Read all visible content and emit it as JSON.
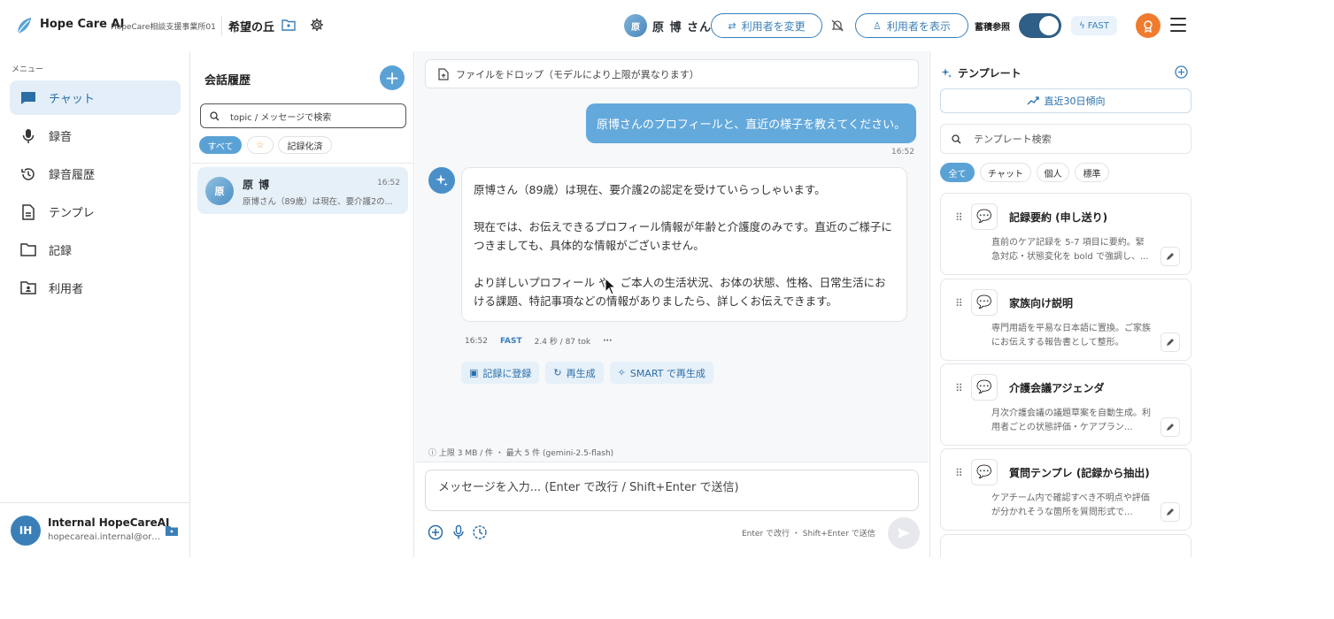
{
  "header": {
    "app_name": "Hope Care AI",
    "office_name": "HopeCare相談支援事業所01",
    "facility_name": "希望の丘",
    "current_user_initial": "原",
    "current_user_name": "原 博 さん",
    "change_user_label": "利用者を変更",
    "show_user_label": "利用者を表示",
    "accumulate_label": "蓄積参照",
    "accumulate_on": true,
    "mode_label": "FAST"
  },
  "sidebar": {
    "menu_title": "メニュー",
    "items": [
      {
        "label": "チャット",
        "icon": "chat-icon",
        "active": true
      },
      {
        "label": "録音",
        "icon": "mic-icon"
      },
      {
        "label": "録音履歴",
        "icon": "history-icon"
      },
      {
        "label": "テンプレ",
        "icon": "document-icon"
      },
      {
        "label": "記録",
        "icon": "folder-icon"
      },
      {
        "label": "利用者",
        "icon": "user-folder-icon"
      }
    ],
    "account": {
      "initials": "IH",
      "name": "Internal HopeCareAI",
      "email": "hopecareai.internal@orde..."
    }
  },
  "history": {
    "title": "会話履歴",
    "search_placeholder": "topic / メッセージで検索",
    "filters": [
      "すべて",
      "☆",
      "記録化済"
    ],
    "conversations": [
      {
        "initial": "原",
        "name": "原 博",
        "time": "16:52",
        "preview": "原博さん（89歳）は現在、要介護2の..."
      }
    ]
  },
  "chat": {
    "dropzone_text": "ファイルをドロップ（モデルにより上限が異なります）",
    "user_message": "原博さんのプロフィールと、直近の様子を教えてください。",
    "user_time": "16:52",
    "ai_paragraphs": [
      "原博さん（89歳）は現在、要介護2の認定を受けていらっしゃいます。",
      "現在では、お伝えできるプロフィール情報が年齢と介護度のみです。直近のご様子につきましても、具体的な情報がございません。",
      "より詳しいプロフィール や、ご本人の生活状況、お体の状態、性格、日常生活における課題、特記事項などの情報がありましたら、詳しくお伝えできます。"
    ],
    "ai_time": "16:52",
    "ai_mode": "FAST",
    "ai_stats": "2.4 秒 / 87 tok",
    "actions": [
      "記録に登録",
      "再生成",
      "SMART で再生成"
    ],
    "limit_note": "上限 3 MB / 件 ・ 最大 5 件 (gemini-2.5-flash)",
    "composer_placeholder": "メッセージを入力... (Enter で改行 / Shift+Enter で送信)",
    "send_hint": "Enter で改行 ・ Shift+Enter で送信"
  },
  "templates": {
    "title": "テンプレート",
    "trend_label": "直近30日傾向",
    "search_placeholder": "テンプレート検索",
    "filters": [
      "全て",
      "チャット",
      "個人",
      "標準"
    ],
    "cards": [
      {
        "title": "記録要約 (申し送り)",
        "desc": "直前のケア記録を 5-7 項目に要約。緊急対応・状態変化を bold で強調し、..."
      },
      {
        "title": "家族向け説明",
        "desc": "専門用語を平易な日本語に置換。ご家族にお伝えする報告書として整形。"
      },
      {
        "title": "介護会議アジェンダ",
        "desc": "月次介護会議の議題草案を自動生成。利用者ごとの状態評価・ケアプラン..."
      },
      {
        "title": "質問テンプレ (記録から抽出)",
        "desc": "ケアチーム内で確認すべき不明点や評価が分かれそうな箇所を質問形式で..."
      }
    ]
  },
  "colors": {
    "accent": "#3b7fb8",
    "active_bg": "#e3eef8",
    "user_bubble": "#63a9dc",
    "toggle_on": "#2f5f86"
  }
}
